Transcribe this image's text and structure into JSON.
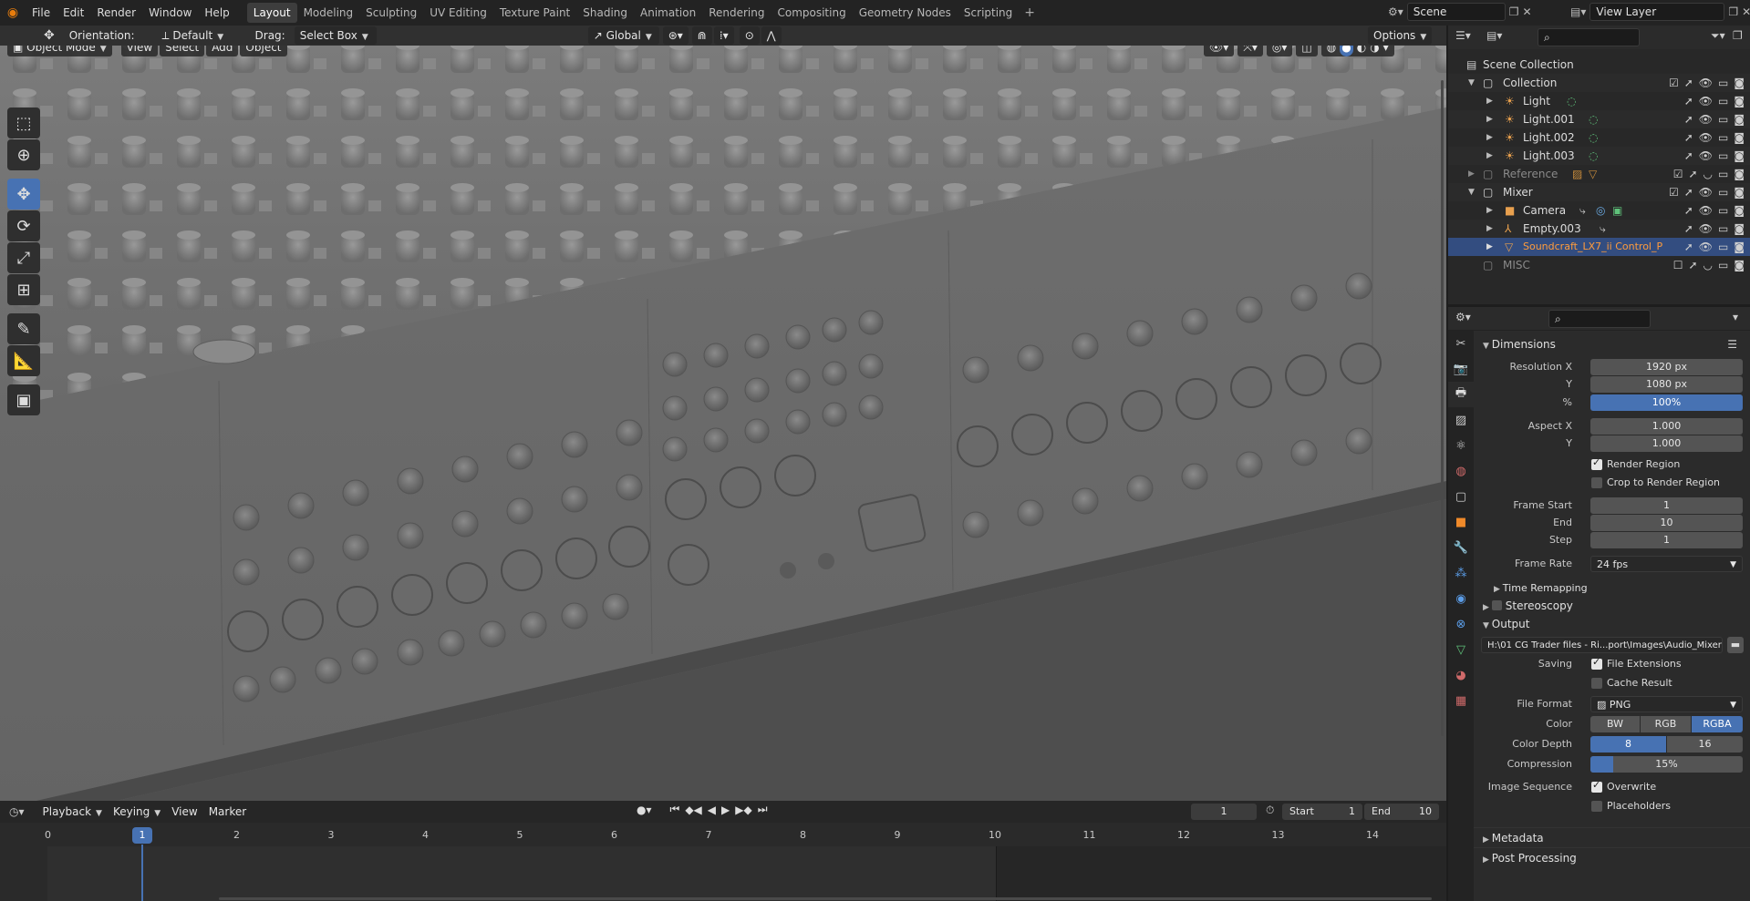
{
  "app": {
    "menus": [
      "File",
      "Edit",
      "Render",
      "Window",
      "Help"
    ],
    "workspaces": [
      "Layout",
      "Modeling",
      "Sculpting",
      "UV Editing",
      "Texture Paint",
      "Shading",
      "Animation",
      "Rendering",
      "Compositing",
      "Geometry Nodes",
      "Scripting"
    ],
    "active_workspace": "Layout",
    "scene": "Scene",
    "view_layer": "View Layer"
  },
  "tool_header": {
    "orientation_label": "Orientation:",
    "orientation_value": "Default",
    "drag_label": "Drag:",
    "drag_value": "Select Box",
    "transform_orientation": "Global",
    "options_label": "Options"
  },
  "viewport": {
    "mode": "Object Mode",
    "menus": [
      "View",
      "Select",
      "Add",
      "Object"
    ],
    "tools": [
      "select-box-icon",
      "cursor-icon",
      "move-icon",
      "rotate-icon",
      "scale-icon",
      "transform-icon",
      "annotate-icon",
      "measure-icon",
      "add-cube-icon"
    ],
    "active_tool": "move-icon"
  },
  "outliner": {
    "search_placeholder": "",
    "rows": [
      {
        "name": "Scene Collection",
        "indent": 0,
        "type": "scene"
      },
      {
        "name": "Collection",
        "indent": 1,
        "type": "collection"
      },
      {
        "name": "Light",
        "indent": 2,
        "type": "light"
      },
      {
        "name": "Light.001",
        "indent": 2,
        "type": "light"
      },
      {
        "name": "Light.002",
        "indent": 2,
        "type": "light"
      },
      {
        "name": "Light.003",
        "indent": 2,
        "type": "light"
      },
      {
        "name": "Reference",
        "indent": 1,
        "type": "collection-dim"
      },
      {
        "name": "Mixer",
        "indent": 1,
        "type": "collection"
      },
      {
        "name": "Camera",
        "indent": 2,
        "type": "camera"
      },
      {
        "name": "Empty.003",
        "indent": 2,
        "type": "empty"
      },
      {
        "name": "Soundcraft_LX7_ii Control_P",
        "indent": 2,
        "type": "mesh-selected"
      },
      {
        "name": "MISC",
        "indent": 1,
        "type": "collection-dim"
      }
    ]
  },
  "properties": {
    "dimensions": {
      "title": "Dimensions",
      "resolution_x_label": "Resolution X",
      "resolution_x": "1920 px",
      "resolution_y_label": "Y",
      "resolution_y": "1080 px",
      "percent_label": "%",
      "percent": "100%",
      "aspect_x_label": "Aspect X",
      "aspect_x": "1.000",
      "aspect_y_label": "Y",
      "aspect_y": "1.000",
      "render_region": "Render Region",
      "crop_region": "Crop to Render Region",
      "frame_start_label": "Frame Start",
      "frame_start": "1",
      "frame_end_label": "End",
      "frame_end": "10",
      "frame_step_label": "Step",
      "frame_step": "1",
      "frame_rate_label": "Frame Rate",
      "frame_rate": "24 fps",
      "time_remapping": "Time Remapping"
    },
    "stereoscopy": "Stereoscopy",
    "output": {
      "title": "Output",
      "path": "H:\\01 CG Trader files - Ri...port\\Images\\Audio_Mixer",
      "saving_label": "Saving",
      "file_extensions": "File Extensions",
      "cache_result": "Cache Result",
      "file_format_label": "File Format",
      "file_format": "PNG",
      "color_label": "Color",
      "color_options": [
        "BW",
        "RGB",
        "RGBA"
      ],
      "color_selected": "RGBA",
      "color_depth_label": "Color Depth",
      "color_depth_options": [
        "8",
        "16"
      ],
      "color_depth_selected": "8",
      "compression_label": "Compression",
      "compression": "15%",
      "compression_value": 0.15,
      "image_sequence_label": "Image Sequence",
      "overwrite": "Overwrite",
      "placeholders": "Placeholders"
    },
    "metadata": "Metadata",
    "post_processing": "Post Processing"
  },
  "timeline": {
    "menus": [
      "Playback",
      "Keying",
      "View",
      "Marker"
    ],
    "current_frame": "1",
    "start_label": "Start",
    "start": "1",
    "end_label": "End",
    "end": "10",
    "ruler": [
      "0",
      "1",
      "2",
      "3",
      "4",
      "5",
      "6",
      "7",
      "8",
      "9",
      "10",
      "11",
      "12",
      "13",
      "14"
    ]
  },
  "colors": {
    "accent": "#4772b3",
    "selected_object": "#ff9c3c"
  }
}
